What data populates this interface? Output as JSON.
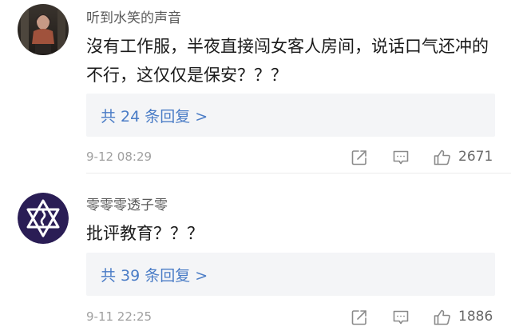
{
  "comments": [
    {
      "username": "听到水笑的声音",
      "text": "沒有工作服，半夜直接闯女客人房间，说话口气还冲的不行，这仅仅是保安？？？",
      "replies_label": "共 24 条回复 >",
      "timestamp": "9-12 08:29",
      "like_count": "2671",
      "avatar": "person-photo"
    },
    {
      "username": "零零零透子零",
      "text": "批评教育？？？",
      "replies_label": "共 39 条回复 >",
      "timestamp": "9-11 22:25",
      "like_count": "1886",
      "avatar": "star-emblem"
    }
  ],
  "icons": {
    "share": "share-icon",
    "comment": "comment-icon",
    "like": "thumbs-up-icon"
  },
  "colors": {
    "link": "#4a7cc6",
    "reply_box": "#f4f5f7",
    "username": "#5a5a5a",
    "meta": "#a0a0a0"
  }
}
